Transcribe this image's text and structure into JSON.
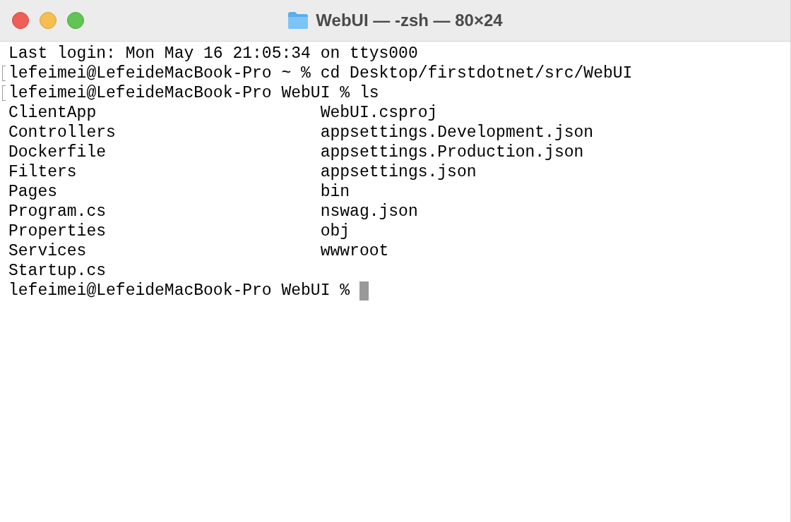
{
  "window": {
    "title": "WebUI — -zsh — 80×24"
  },
  "lines": [
    {
      "text": "Last login: Mon May 16 21:05:34 on ttys000",
      "marked": false
    },
    {
      "text": "lefeimei@LefeideMacBook-Pro ~ % cd Desktop/firstdotnet/src/WebUI",
      "marked": true
    },
    {
      "text": "lefeimei@LefeideMacBook-Pro WebUI % ls",
      "marked": true
    }
  ],
  "listing": [
    [
      "ClientApp",
      "WebUI.csproj"
    ],
    [
      "Controllers",
      "appsettings.Development.json"
    ],
    [
      "Dockerfile",
      "appsettings.Production.json"
    ],
    [
      "Filters",
      "appsettings.json"
    ],
    [
      "Pages",
      "bin"
    ],
    [
      "Program.cs",
      "nswag.json"
    ],
    [
      "Properties",
      "obj"
    ],
    [
      "Services",
      "wwwroot"
    ],
    [
      "Startup.cs"
    ]
  ],
  "prompt": "lefeimei@LefeideMacBook-Pro WebUI %"
}
